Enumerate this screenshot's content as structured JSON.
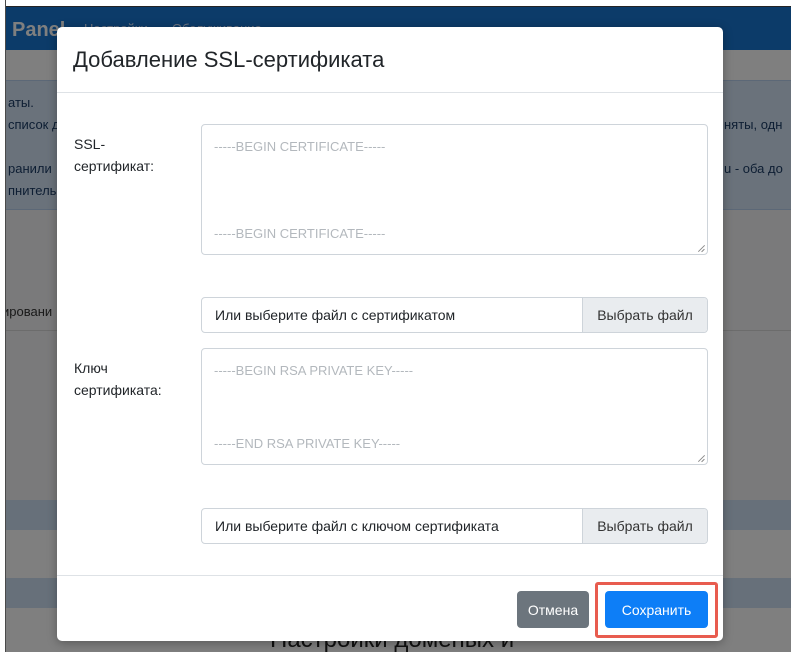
{
  "background": {
    "brand": "Panel",
    "nav": [
      "Настройки",
      "Обслуживание"
    ],
    "alert_lines": [
      {
        "left": "аты.",
        "right": ""
      },
      {
        "left": "список д",
        "right": "няты, одн"
      },
      {
        "left": "ранили",
        "right": "u - оба до"
      },
      {
        "left": "пнитель",
        "right": ""
      }
    ],
    "section_text": "ировани",
    "heading": "Настройки доменых и"
  },
  "modal": {
    "title": "Добавление SSL-сертификата",
    "cert_label": "SSL-сертификат:",
    "cert_placeholder_begin": "-----BEGIN CERTIFICATE-----",
    "cert_placeholder_end": "-----BEGIN CERTIFICATE-----",
    "cert_file_label": "Или выберите файл с сертификатом",
    "cert_file_button": "Выбрать файл",
    "key_label": "Ключ сертификата:",
    "key_placeholder_begin": "-----BEGIN RSA PRIVATE KEY-----",
    "key_placeholder_end": "-----END RSA PRIVATE KEY-----",
    "key_file_label": "Или выберите файл с ключом сертификата",
    "key_file_button": "Выбрать файл",
    "cancel_label": "Отмена",
    "save_label": "Сохранить"
  },
  "colors": {
    "primary": "#0d7ef7",
    "secondary": "#6c757d",
    "highlight": "#e85c4f",
    "navbar": "#1976d2"
  }
}
